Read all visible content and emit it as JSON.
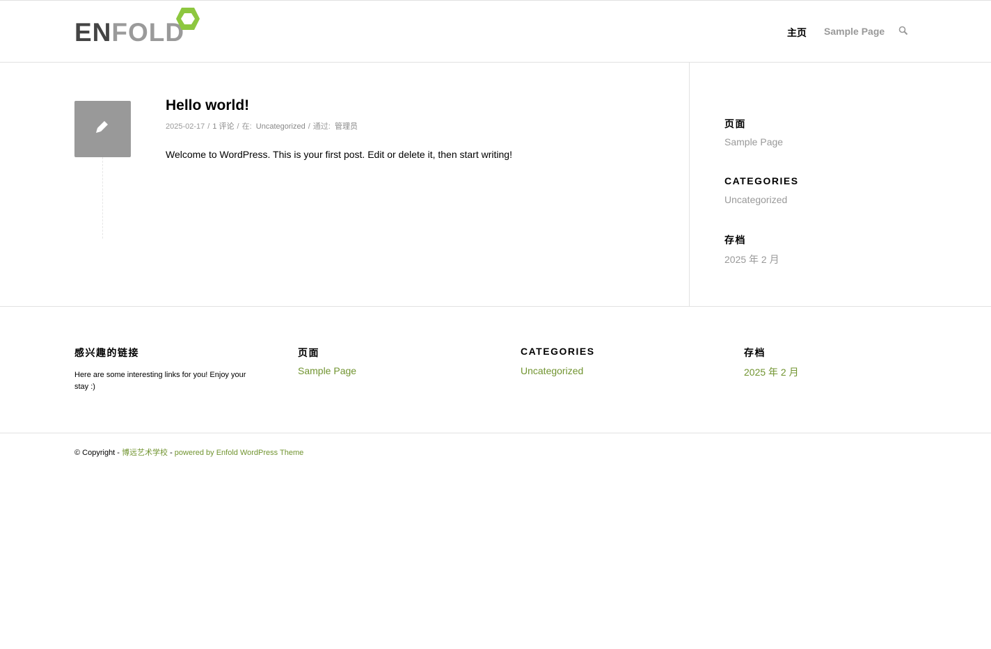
{
  "header": {
    "logo": {
      "part1": "EN",
      "part2": "FOLD",
      "accent_color": "#8dc73f"
    },
    "nav": [
      {
        "label": "主页",
        "active": true
      },
      {
        "label": "Sample Page",
        "active": false
      }
    ],
    "search_icon": "search-icon"
  },
  "post": {
    "icon": "pencil-icon",
    "title": "Hello world!",
    "meta": {
      "date": "2025-02-17",
      "comments": "1 评论",
      "in_label": "在:",
      "category": "Uncategorized",
      "by_label": "通过:",
      "author": "管理员"
    },
    "body": "Welcome to WordPress. This is your first post. Edit or delete it, then start writing!"
  },
  "sidebar": {
    "pages_title": "页面",
    "pages_link": "Sample Page",
    "categories_title": "CATEGORIES",
    "categories_link": "Uncategorized",
    "archives_title": "存档",
    "archives_link": "2025 年 2 月"
  },
  "footer": {
    "links_title": "感兴趣的链接",
    "links_text": "Here are some interesting links for you! Enjoy your stay :)",
    "pages_title": "页面",
    "pages_link": "Sample Page",
    "categories_title": "CATEGORIES",
    "categories_link": "Uncategorized",
    "archives_title": "存档",
    "archives_link": "2025 年 2 月",
    "link_color": "#719430"
  },
  "copyright": {
    "prefix": "© Copyright - ",
    "site": "博远艺术学校",
    "separator": " - ",
    "powered": "powered by Enfold WordPress Theme"
  }
}
